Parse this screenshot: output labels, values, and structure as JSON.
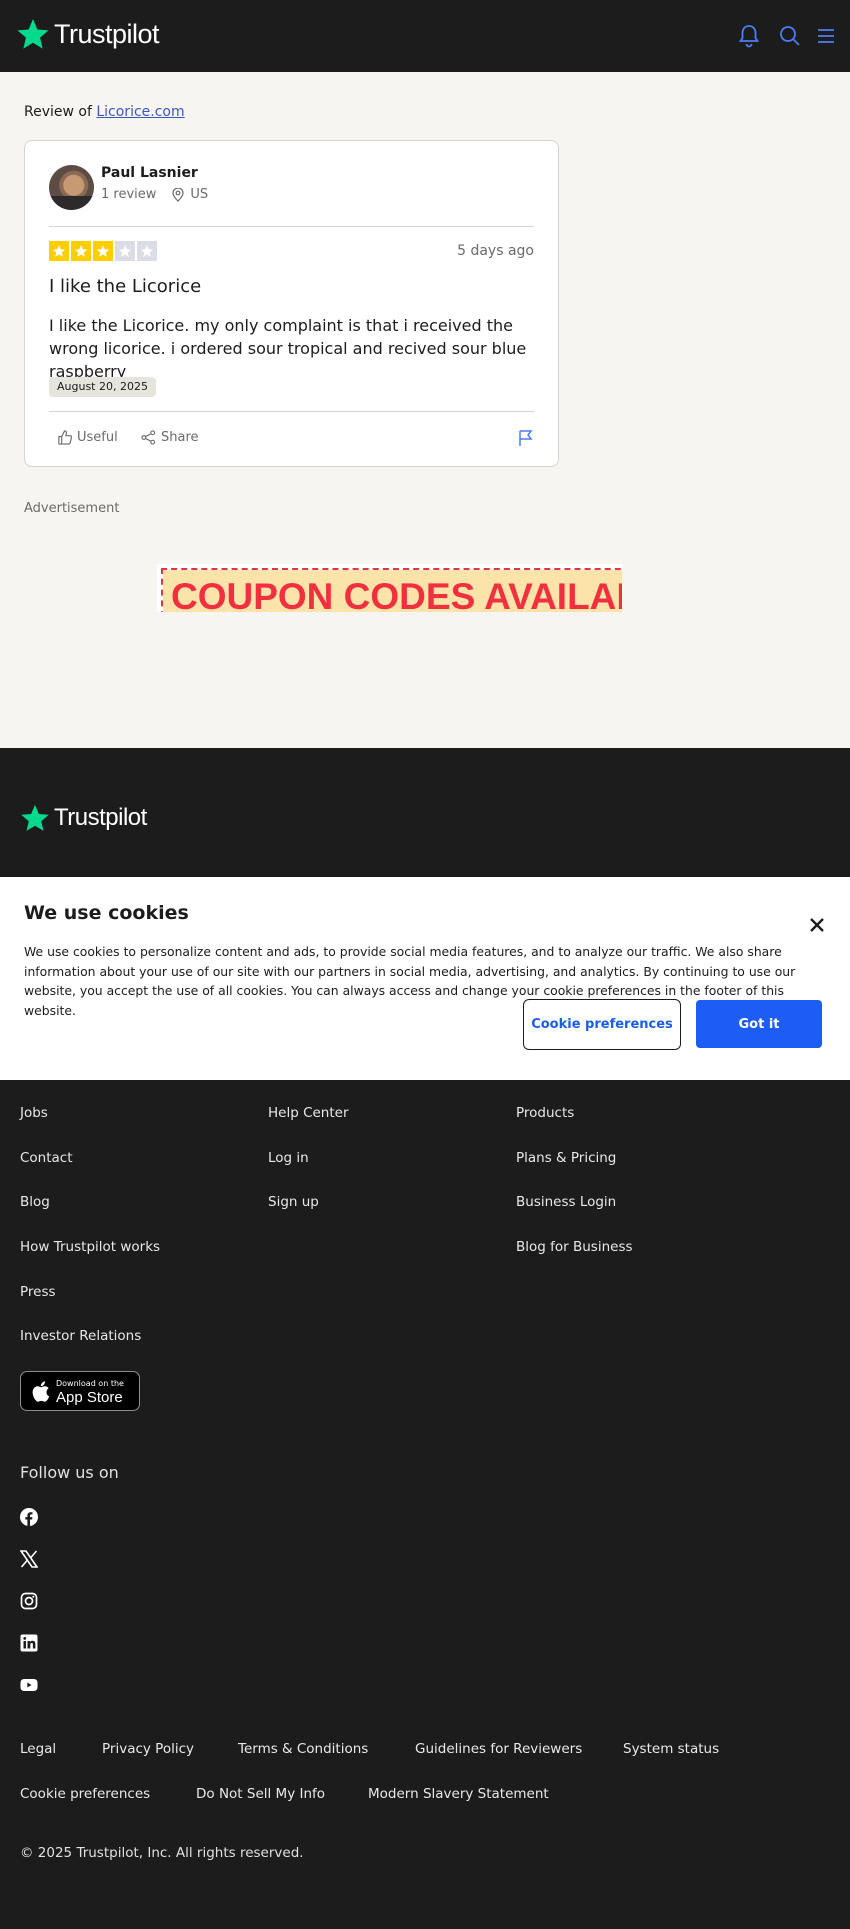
{
  "header": {
    "logo_text": "Trustpilot",
    "brand_color": "#04da8d",
    "icons": [
      "bell-icon",
      "search-icon",
      "menu-icon"
    ]
  },
  "review": {
    "prefix": "Review of",
    "company_link": "Licorice.com",
    "reviewer_name": "Paul Lasnier",
    "review_count": "1 review",
    "country": "US",
    "rating": 3,
    "rating_max": 5,
    "star_color_filled": "#ffce00",
    "star_color_empty": "#dcdce6",
    "date_relative": "5 days ago",
    "title": "I like the Licorice",
    "body": "I like the Licorice. my only complaint is that i received the wrong licorice. i ordered sour tropical and recived sour blue raspberry",
    "date_of_experience": "August 20, 2025",
    "useful_label": "Useful",
    "share_label": "Share"
  },
  "ad": {
    "label": "Advertisement",
    "banner_text": "COUPON CODES AVAILABLE"
  },
  "footer": {
    "logo_text": "Trustpilot",
    "col1": [
      "Jobs",
      "Contact",
      "Blog",
      "How Trustpilot works",
      "Press",
      "Investor Relations"
    ],
    "col2": [
      "Help Center",
      "Log in",
      "Sign up"
    ],
    "col3": [
      "Products",
      "Plans & Pricing",
      "Business Login",
      "Blog for Business"
    ],
    "appstore_small": "Download on the",
    "appstore_big": "App Store",
    "follow_label": "Follow us on",
    "social_icons": [
      "facebook-icon",
      "x-icon",
      "instagram-icon",
      "linkedin-icon",
      "youtube-icon"
    ],
    "legal_row1": [
      "Legal",
      "Privacy Policy",
      "Terms & Conditions",
      "Guidelines for Reviewers",
      "System status"
    ],
    "legal_row2": [
      "Cookie preferences",
      "Do Not Sell My Info",
      "Modern Slavery Statement"
    ],
    "copyright": "© 2025 Trustpilot, Inc. All rights reserved."
  },
  "cookie_banner": {
    "title": "We use cookies",
    "text": "We use cookies to personalize content and ads, to provide social media features, and to analyze our traffic. We also share information about your use of our site with our partners in social media, advertising, and analytics. By continuing to use our website, you accept the use of all cookies. You can always access and change your cookie preferences in the footer of this website.",
    "preferences_button": "Cookie preferences",
    "accept_button": "Got it",
    "accent_color": "#1e5cf6"
  }
}
